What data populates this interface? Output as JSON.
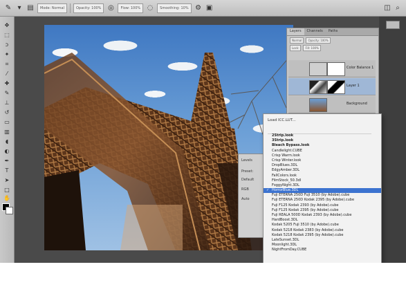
{
  "toolbar": {
    "fields": [
      "Mode: Normal",
      "Opacity: 100%",
      "Flow: 100%",
      "Smoothing: 10%"
    ]
  },
  "layers": {
    "tabs": [
      "Layers",
      "Channels",
      "Paths"
    ],
    "row1": [
      "Normal",
      "Opacity: 100%"
    ],
    "row2": [
      "Lock:",
      "Fill: 100%"
    ],
    "items": [
      {
        "name": "Color Balance 1"
      },
      {
        "name": "Layer 1"
      },
      {
        "name": "Background"
      }
    ]
  },
  "adjustments": {
    "labels": [
      "Levels",
      "Preset:",
      "Default",
      "RGB",
      "Auto"
    ]
  },
  "menu": {
    "title": "Load ICC.LUT...",
    "selected_index": 11,
    "items": [
      {
        "label": "2Strip.look",
        "bold": true
      },
      {
        "label": "3Strip.look",
        "bold": true
      },
      {
        "label": "Bleach Bypass.look",
        "bold": true
      },
      {
        "label": "Candlelight.CUBE",
        "bold": false
      },
      {
        "label": "Crisp Warm.look",
        "bold": false
      },
      {
        "label": "Crisp Winter.look",
        "bold": false
      },
      {
        "label": "DropBlues.3DL",
        "bold": false
      },
      {
        "label": "EdgyAmber.3DL",
        "bold": false
      },
      {
        "label": "FallColors.look",
        "bold": false
      },
      {
        "label": "FilmStock_50.3dl",
        "bold": false
      },
      {
        "label": "FoggyNight.3DL",
        "bold": false
      },
      {
        "label": "HorrorBlue.3DL",
        "bold": false
      },
      {
        "label": "Fuji ETERNA 250D Fuji 3510 (by Adobe).cube",
        "bold": false
      },
      {
        "label": "Fuji ETERNA 250D Kodak 2395 (by Adobe).cube",
        "bold": false
      },
      {
        "label": "Fuji F125 Kodak 2393 (by Adobe).cube",
        "bold": false
      },
      {
        "label": "Fuji F125 Kodak 2395 (by Adobe).cube",
        "bold": false
      },
      {
        "label": "Fuji REALA 500D Kodak 2393 (by Adobe).cube",
        "bold": false
      },
      {
        "label": "HardBoost.3DL",
        "bold": false
      },
      {
        "label": "Kodak 5205 Fuji 3510 (by Adobe).cube",
        "bold": false
      },
      {
        "label": "Kodak 5218 Kodak 2383 (by Adobe).cube",
        "bold": false
      },
      {
        "label": "Kodak 5218 Kodak 2395 (by Adobe).cube",
        "bold": false
      },
      {
        "label": "LateSunset.3DL",
        "bold": false
      },
      {
        "label": "Moonlight.3DL",
        "bold": false
      },
      {
        "label": "NightFromDay.CUBE",
        "bold": false
      }
    ]
  }
}
